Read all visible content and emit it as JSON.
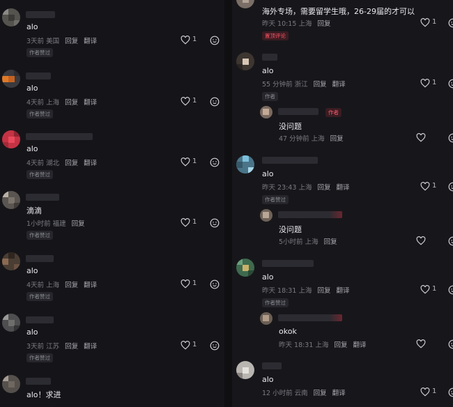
{
  "left_comments": [
    {
      "text": "alo",
      "time": "3天前",
      "location": "美国",
      "reply": "回复",
      "translate": "翻译",
      "badge": "作者赞过",
      "likes": "1"
    },
    {
      "text": "alo",
      "time": "4天前",
      "location": "上海",
      "reply": "回复",
      "translate": "翻译",
      "badge": "作者赞过",
      "likes": "1"
    },
    {
      "text": "alo",
      "time": "4天前",
      "location": "湖北",
      "reply": "回复",
      "translate": "翻译",
      "badge": "作者赞过",
      "likes": "1"
    },
    {
      "text": "滴滴",
      "time": "1小时前",
      "location": "福建",
      "reply": "回复",
      "badge": "作者赞过",
      "likes": "1"
    },
    {
      "text": "alo",
      "time": "4天前",
      "location": "上海",
      "reply": "回复",
      "translate": "翻译",
      "badge": "作者赞过",
      "likes": "1"
    },
    {
      "text": "alo",
      "time": "3天前",
      "location": "江苏",
      "reply": "回复",
      "translate": "翻译",
      "badge": "作者赞过",
      "likes": "1"
    },
    {
      "text": "alo！求进"
    }
  ],
  "right_top": {
    "text": "海外专场，需要留学生哦，26-29届的才可以",
    "time": "昨天 10:15",
    "location": "上海",
    "reply": "回复",
    "badge": "置顶评论",
    "likes": "1"
  },
  "right_comments": [
    {
      "text": "alo",
      "time": "55 分钟前",
      "location": "浙江",
      "reply": "回复",
      "translate": "翻译",
      "badge": "作者",
      "likes": "1"
    },
    {
      "text": "alo",
      "time": "昨天 23:43",
      "location": "上海",
      "reply": "回复",
      "translate": "翻译",
      "badge": "作者赞过",
      "likes": "1"
    },
    {
      "text": "alo",
      "time": "昨天 18:31",
      "location": "上海",
      "reply": "回复",
      "translate": "翻译",
      "badge": "作者赞过",
      "likes": "1"
    },
    {
      "text": "alo",
      "time": "12 小时前",
      "location": "云南",
      "reply": "回复",
      "translate": "翻译",
      "likes": "1"
    }
  ],
  "right_replies": [
    {
      "text": "没问题",
      "time": "47 分钟前",
      "location": "上海",
      "reply": "回复",
      "author_tag": "作者"
    },
    {
      "text": "没问题",
      "time": "5小时前",
      "location": "上海",
      "reply": "回复"
    },
    {
      "text": "okok",
      "time": "昨天 18:31",
      "location": "上海",
      "reply": "回复",
      "translate": "翻译"
    }
  ],
  "icons": {
    "like": "heart-outline-icon",
    "emoji": "emoji-smile-icon"
  },
  "colors": {
    "bg": "#16161a",
    "text": "#e9e9ee",
    "meta": "#7a7a82",
    "accent": "#ff5466"
  }
}
